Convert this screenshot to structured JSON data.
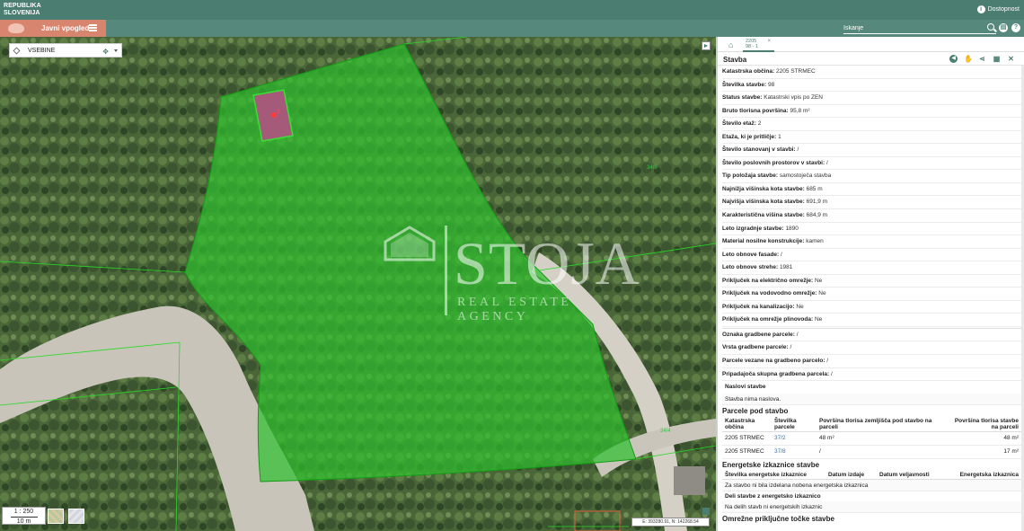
{
  "header": {
    "logo_line1": "REPUBLIKA",
    "logo_line2": "SLOVENIJA",
    "accessibility": "Dostopnost",
    "accessibility_icon": "info-icon"
  },
  "app": {
    "title": "Javni vpogled",
    "search_placeholder": "Iskanje"
  },
  "map": {
    "content_select": "VSEBINE",
    "scale_ratio": "1 : 250",
    "scale_length": "10 m",
    "coordinates": "E: 393280.91, N: 142268.54",
    "parcel_label_1": "37/2",
    "parcel_label_2": "34/9",
    "parcel_label_3": "34/4",
    "building_label": "2",
    "watermark_main": "STOJA",
    "watermark_sub": "REAL ESTATE AGENCY"
  },
  "panel": {
    "tab_title": "2205",
    "tab_subtitle": "98 - 1",
    "tab_close": "×",
    "section_title": "Stavba",
    "attributes": [
      {
        "label": "Katastrska občina:",
        "value": "2205 STRMEC"
      },
      {
        "label": "Številka stavbe:",
        "value": "98"
      },
      {
        "label": "Status stavbe:",
        "value": "Katastrski vpis po ZEN"
      },
      {
        "label": "Bruto tlorisna površina:",
        "value": "95,8 m²"
      },
      {
        "label": "Število etaž:",
        "value": "2"
      },
      {
        "label": "Etaža, ki je pritličje:",
        "value": "1"
      },
      {
        "label": "Število stanovanj v stavbi:",
        "value": "/"
      },
      {
        "label": "Število poslovnih prostorov v stavbi:",
        "value": "/"
      },
      {
        "label": "Tip položaja stavbe:",
        "value": "samostoječa stavba"
      },
      {
        "label": "Najnižja višinska kota stavbe:",
        "value": "685 m"
      },
      {
        "label": "Najvišja višinska kota stavbe:",
        "value": "691,9 m"
      },
      {
        "label": "Karakteristična višina stavbe:",
        "value": "684,9 m"
      },
      {
        "label": "Leto izgradnje stavbe:",
        "value": "1890"
      },
      {
        "label": "Material nosilne konstrukcije:",
        "value": "kamen"
      },
      {
        "label": "Leto obnove fasade:",
        "value": "/"
      },
      {
        "label": "Leto obnove strehe:",
        "value": "1981"
      },
      {
        "label": "Priključek na električno omrežje:",
        "value": "Ne"
      },
      {
        "label": "Priključek na vodovodno omrežje:",
        "value": "Ne"
      },
      {
        "label": "Priključek na kanalizacijo:",
        "value": "Ne"
      },
      {
        "label": "Priključek na omrežje plinovoda:",
        "value": "Ne"
      }
    ],
    "attributes2": [
      {
        "label": "Oznaka gradbene parcele:",
        "value": "/"
      },
      {
        "label": "Vrsta gradbene parcele:",
        "value": "/"
      },
      {
        "label": "Parcele vezane na gradbeno parcelo:",
        "value": "/"
      },
      {
        "label": "Pripadajoča skupna gradbena parcela:",
        "value": "/"
      }
    ],
    "addresses": {
      "title": "Naslovi stavbe",
      "empty": "Stavba nima naslova."
    },
    "parcels": {
      "title": "Parcele pod stavbo",
      "headers": [
        "Katastrska občina",
        "Številka parcele",
        "Površina tlorisa zemljišča pod stavbo na parceli",
        "Površina tlorisa stavbe na parceli"
      ],
      "rows": [
        [
          "2205 STRMEC",
          "37/2",
          "48 m²",
          "48 m²"
        ],
        [
          "2205 STRMEC",
          "37/8",
          "/",
          "17 m²"
        ]
      ]
    },
    "energy": {
      "title": "Energetske izkaznice stavbe",
      "headers": [
        "Številka energetske izkaznice",
        "Datum izdaje",
        "Datum veljavnosti",
        "Energetska izkaznica"
      ],
      "empty": "Za stavbo ni bila izdelana nobena energetska izkaznica"
    },
    "parts": {
      "title": "Deli stavbe z energetsko izkaznico",
      "empty": "Na delih stavb ni energetskih izkaznic"
    },
    "network": {
      "title": "Omrežne priključne točke stavbe"
    }
  },
  "colors": {
    "header": "#4b7d70",
    "brand": "#d7856f",
    "parcel_fill": "#2fbf2f"
  }
}
